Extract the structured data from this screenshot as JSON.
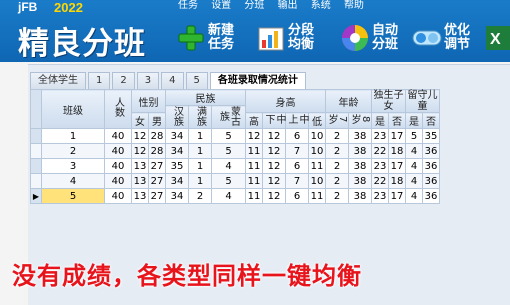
{
  "app": {
    "brand": "jFB",
    "year": "2022",
    "title": "精良分班"
  },
  "topmenu": [
    "任务",
    "设置",
    "分班",
    "输出",
    "系统",
    "帮助"
  ],
  "toolbar": [
    {
      "label": "新建\n任务",
      "icon": "plus-icon"
    },
    {
      "label": "分段\n均衡",
      "icon": "bar-chart-icon"
    },
    {
      "label": "自动\n分班",
      "icon": "color-wheel-icon"
    },
    {
      "label": "优化\n调节",
      "icon": "optimize-icon"
    }
  ],
  "tabs": [
    "全体学生",
    "1",
    "2",
    "3",
    "4",
    "5",
    "各班录取情况统计"
  ],
  "active_tab": 6,
  "table": {
    "headers": {
      "class": "班级",
      "count": "人数",
      "gender": "性别",
      "male": "男",
      "female": "女",
      "ethnicity": "民族",
      "han": "汉族",
      "man": "满族",
      "mongol": "蒙古族",
      "height": "身高",
      "h_high": "高",
      "h_midhigh": "中上",
      "h_mid": "中下",
      "h_low": "低",
      "age": "年龄",
      "age7": "7岁",
      "age8": "8岁",
      "only": "独生子女",
      "left": "留守儿童",
      "yes": "是",
      "no": "否"
    },
    "rows": [
      {
        "cls": "1",
        "v": [
          "40",
          "12",
          "28",
          "34",
          "1",
          "5",
          "12",
          "12",
          "6",
          "10",
          "2",
          "38",
          "23",
          "17",
          "5",
          "35"
        ]
      },
      {
        "cls": "2",
        "v": [
          "40",
          "12",
          "28",
          "34",
          "1",
          "5",
          "11",
          "12",
          "7",
          "10",
          "2",
          "38",
          "22",
          "18",
          "4",
          "36"
        ]
      },
      {
        "cls": "3",
        "v": [
          "40",
          "13",
          "27",
          "35",
          "1",
          "4",
          "11",
          "12",
          "6",
          "11",
          "2",
          "38",
          "23",
          "17",
          "4",
          "36"
        ]
      },
      {
        "cls": "4",
        "v": [
          "40",
          "13",
          "27",
          "34",
          "1",
          "5",
          "11",
          "12",
          "7",
          "10",
          "2",
          "38",
          "22",
          "18",
          "4",
          "36"
        ]
      },
      {
        "cls": "5",
        "v": [
          "40",
          "13",
          "27",
          "34",
          "2",
          "4",
          "11",
          "12",
          "6",
          "11",
          "2",
          "38",
          "23",
          "17",
          "4",
          "36"
        ]
      }
    ]
  },
  "caption": "没有成绩，各类型同样一键均衡"
}
